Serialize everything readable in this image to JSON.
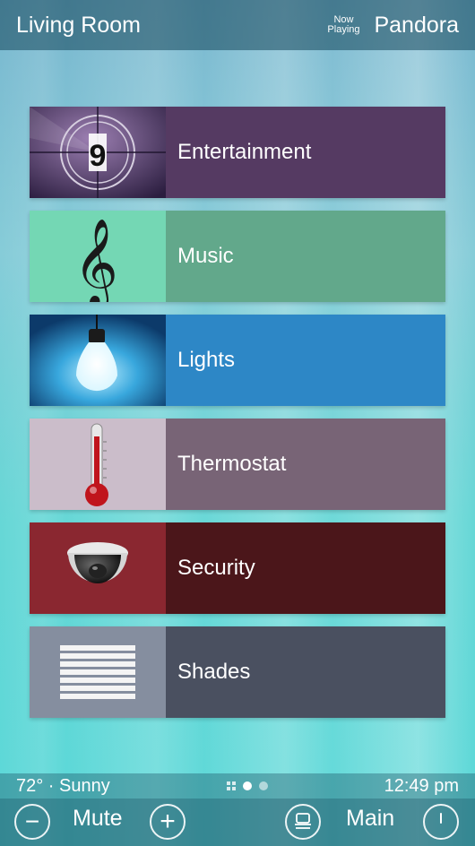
{
  "header": {
    "room": "Living Room",
    "now_playing_label": "Now Playing",
    "source": "Pandora"
  },
  "tiles": [
    {
      "label": "Entertainment",
      "icon": "film-countdown-icon",
      "icon_text": "9"
    },
    {
      "label": "Music",
      "icon": "treble-clef-icon",
      "icon_text": "𝄞"
    },
    {
      "label": "Lights",
      "icon": "light-bulb-icon"
    },
    {
      "label": "Thermostat",
      "icon": "thermometer-icon"
    },
    {
      "label": "Security",
      "icon": "security-camera-icon"
    },
    {
      "label": "Shades",
      "icon": "window-blinds-icon"
    }
  ],
  "status": {
    "weather": "72° · Sunny",
    "time": "12:49 pm",
    "page_count": 2,
    "active_page": 1
  },
  "controls": {
    "minus": "−",
    "mute": "Mute",
    "plus": "+",
    "main": "Main"
  },
  "colors": {
    "entertainment": "#553a62",
    "music": "#62a88b",
    "lights": "#2d87c6",
    "thermostat": "#786476",
    "security": "#4b161a",
    "shades": "#4a5060"
  }
}
